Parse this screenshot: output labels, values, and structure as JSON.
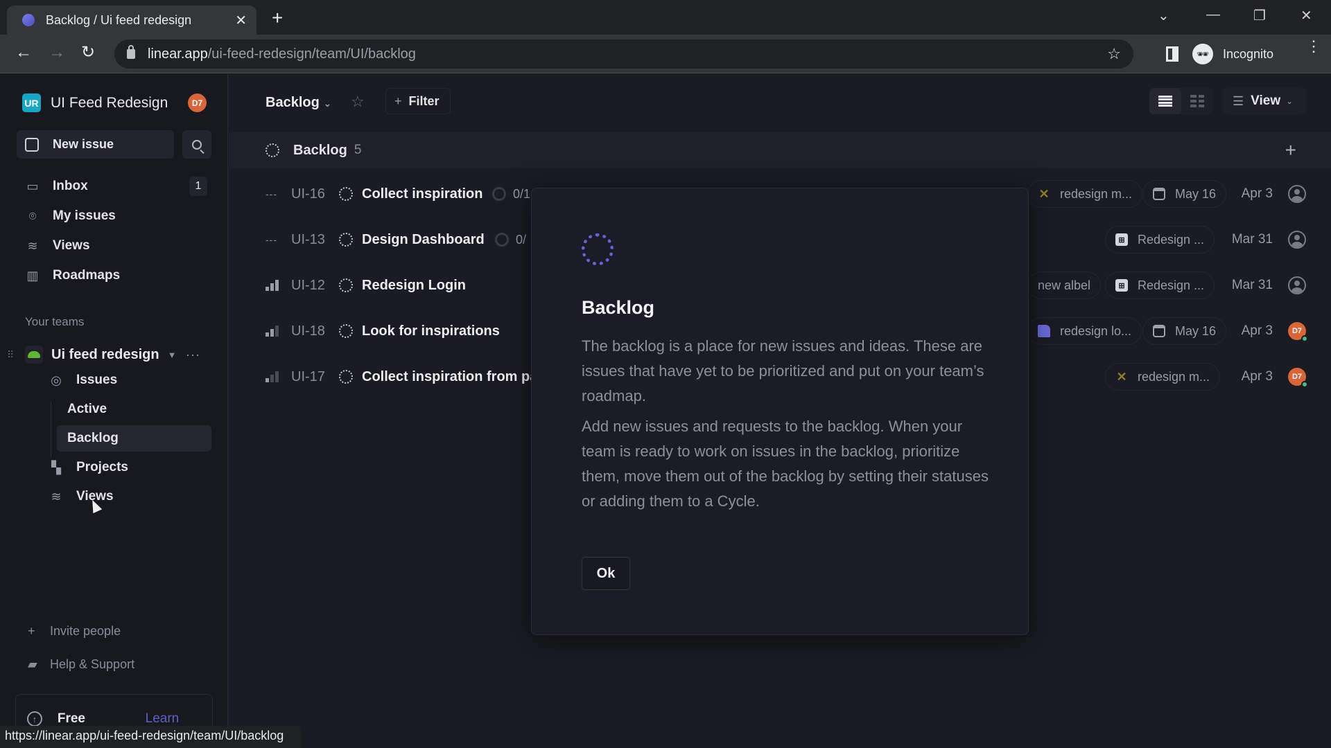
{
  "browser": {
    "tab_title": "Backlog / Ui feed redesign",
    "url_host": "linear.app",
    "url_path": "/ui-feed-redesign/team/UI/backlog",
    "profile_label": "Incognito",
    "status_url": "https://linear.app/ui-feed-redesign/team/UI/backlog"
  },
  "sidebar": {
    "workspace": {
      "logo": "UR",
      "name": "UI Feed Redesign",
      "avatar": "D7"
    },
    "new_issue_label": "New issue",
    "items": [
      {
        "label": "Inbox",
        "icon": "inbox-icon",
        "badge": "1"
      },
      {
        "label": "My issues",
        "icon": "target-icon"
      },
      {
        "label": "Views",
        "icon": "layers-icon"
      },
      {
        "label": "Roadmaps",
        "icon": "map-icon"
      }
    ],
    "teams_heading": "Your teams",
    "team": {
      "name": "Ui feed redesign",
      "items": [
        {
          "label": "Issues",
          "icon": "issues-icon"
        },
        {
          "label": "Active"
        },
        {
          "label": "Backlog",
          "active": true
        },
        {
          "label": "Projects",
          "icon": "projects-icon"
        },
        {
          "label": "Views",
          "icon": "layers-icon"
        }
      ]
    },
    "invite_label": "Invite people",
    "help_label": "Help & Support",
    "plan": {
      "label": "Free Plan",
      "link": "Learn more"
    }
  },
  "header": {
    "title": "Backlog",
    "filter_label": "Filter",
    "view_label": "View"
  },
  "group": {
    "label": "Backlog",
    "count": "5"
  },
  "issues": [
    {
      "priority": "none",
      "id": "UI-16",
      "title": "Collect inspiration",
      "progress": "0/1",
      "label": "redesign m...",
      "label_icon": "cross",
      "due": "May 16",
      "date": "Apr 3",
      "assignee": ""
    },
    {
      "priority": "none",
      "id": "UI-13",
      "title": "Design Dashboard",
      "progress": "0/",
      "label": "Redesign ...",
      "label_icon": "proj",
      "due": "",
      "date": "Mar 31",
      "assignee": ""
    },
    {
      "priority": "high",
      "id": "UI-12",
      "title": "Redesign Login",
      "extra_label": "new albel",
      "label": "Redesign ...",
      "label_icon": "proj",
      "due": "",
      "date": "Mar 31",
      "assignee": ""
    },
    {
      "priority": "medium",
      "id": "UI-18",
      "title": "Look for inspirations",
      "label": "redesign lo...",
      "label_icon": "doc",
      "due": "May 16",
      "date": "Apr 3",
      "assignee": "D7"
    },
    {
      "priority": "low",
      "id": "UI-17",
      "title": "Collect inspiration from pa",
      "label": "redesign m...",
      "label_icon": "cross",
      "due": "",
      "date": "Apr 3",
      "assignee": "D7"
    }
  ],
  "modal": {
    "title": "Backlog",
    "paragraph1": "The backlog is a place for new issues and ideas. These are issues that have yet to be prioritized and put on your team’s roadmap.",
    "paragraph2": "Add new issues and requests to the backlog. When your team is ready to work on issues in the backlog, prioritize them, move them out of the backlog by setting their statuses or adding them to a Cycle.",
    "ok_label": "Ok"
  },
  "colors": {
    "accent": "#6464d4",
    "workspace_logo": "#1aa5c2",
    "avatar": "#d7663a",
    "online": "#4cb782",
    "team_icon": "#5fb832"
  }
}
